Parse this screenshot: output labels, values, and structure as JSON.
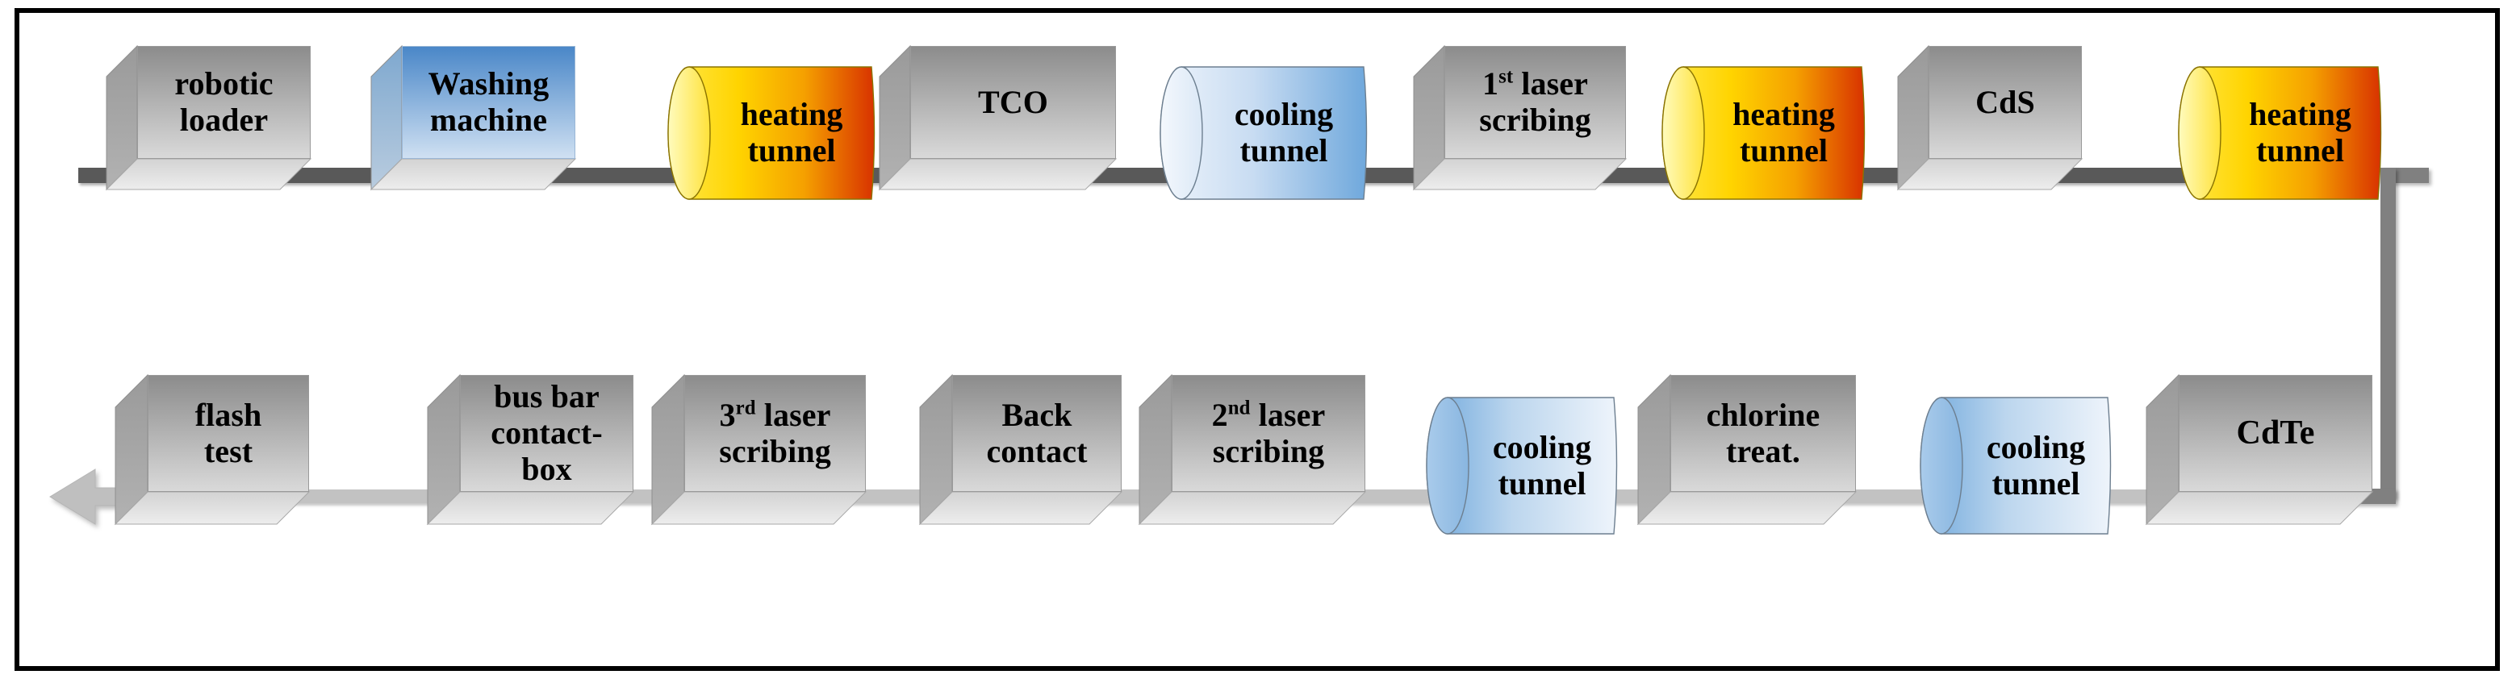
{
  "diagram": {
    "title": "CdTe thin-film photovoltaic module production line flow diagram",
    "rows": [
      {
        "id": "top-row",
        "direction": "left-to-right",
        "nodes": [
          {
            "id": "robotic-loader",
            "shape": "box",
            "label": "robotic\nloader",
            "color_name": "gray",
            "color": "#a6a6a6"
          },
          {
            "id": "washing-machine",
            "shape": "box",
            "label": "Washing\nmachine",
            "color_name": "blue",
            "color": "#5b9bd5"
          },
          {
            "id": "heating-tunnel-1",
            "shape": "cylinder",
            "label": "heating\ntunnel",
            "color_name": "yellow-red",
            "color": "#ffd400"
          },
          {
            "id": "tco",
            "shape": "box",
            "label": "TCO",
            "color_name": "gray",
            "color": "#a6a6a6"
          },
          {
            "id": "cooling-tunnel-1",
            "shape": "cylinder",
            "label": "cooling\ntunnel",
            "color_name": "light-blue",
            "color": "#bdd7ee"
          },
          {
            "id": "laser-scribing-1",
            "shape": "box",
            "label": "1|st| laser\nscribing",
            "color_name": "gray",
            "color": "#a6a6a6"
          },
          {
            "id": "heating-tunnel-2",
            "shape": "cylinder",
            "label": "heating\ntunnel",
            "color_name": "yellow-red",
            "color": "#ffd400"
          },
          {
            "id": "cds",
            "shape": "box",
            "label": "CdS",
            "color_name": "gray",
            "color": "#a6a6a6"
          },
          {
            "id": "heating-tunnel-3",
            "shape": "cylinder",
            "label": "heating\ntunnel",
            "color_name": "yellow-red",
            "color": "#ffd400"
          }
        ]
      },
      {
        "id": "bottom-row",
        "direction": "right-to-left",
        "nodes": [
          {
            "id": "flash-test",
            "shape": "box",
            "label": "flash\ntest",
            "color_name": "gray",
            "color": "#a6a6a6"
          },
          {
            "id": "bus-bar-contactbox",
            "shape": "box",
            "label": "bus bar\ncontact-\nbox",
            "color_name": "gray",
            "color": "#a6a6a6"
          },
          {
            "id": "laser-scribing-3",
            "shape": "box",
            "label": "3|rd|  laser\nscribing",
            "color_name": "gray",
            "color": "#a6a6a6"
          },
          {
            "id": "back-contact",
            "shape": "box",
            "label": "Back\ncontact",
            "color_name": "gray",
            "color": "#a6a6a6"
          },
          {
            "id": "laser-scribing-2",
            "shape": "box",
            "label": "2|nd| laser\nscribing",
            "color_name": "gray",
            "color": "#a6a6a6"
          },
          {
            "id": "cooling-tunnel-2",
            "shape": "cylinder",
            "label": "cooling\ntunnel",
            "color_name": "light-blue",
            "color": "#bdd7ee"
          },
          {
            "id": "chlorine-treatment",
            "shape": "box",
            "label": "chlorine\ntreat.",
            "color_name": "gray",
            "color": "#a6a6a6"
          },
          {
            "id": "cooling-tunnel-3",
            "shape": "cylinder",
            "label": "cooling\ntunnel",
            "color_name": "light-blue",
            "color": "#bdd7ee"
          },
          {
            "id": "cdte",
            "shape": "box",
            "label": "CdTe",
            "color_name": "gray",
            "color": "#a6a6a6"
          }
        ]
      }
    ],
    "output_arrow": {
      "id": "output-arrow",
      "label": "",
      "direction": "left"
    },
    "colors": {
      "border": "#000000",
      "background": "#ffffff",
      "line_top": "#595959",
      "line_bottom": "#c2c2c2",
      "line_loop": "#808080",
      "arrow": "#bfbfbf",
      "box_gray_top": "#8c8c8c",
      "box_gray_bottom": "#d9d9d9",
      "box_blue_top": "#4a87c8",
      "box_blue_bottom": "#cfe0f2",
      "heat_yellow": "#ffe94e",
      "heat_orange": "#f5a000",
      "heat_red": "#d83200",
      "cool_light": "#eef4fb",
      "cool_blue": "#6fa8dc"
    }
  }
}
